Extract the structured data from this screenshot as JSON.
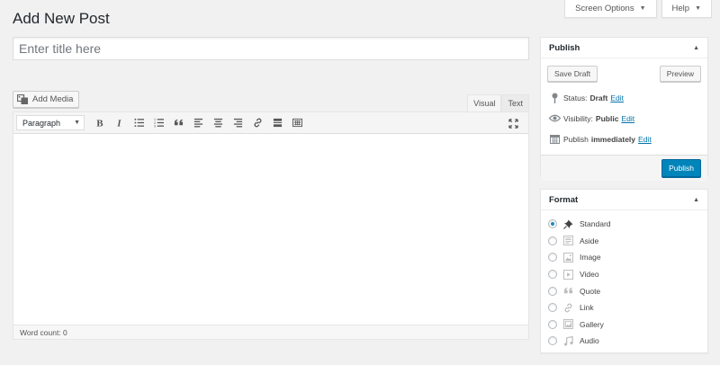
{
  "page": {
    "title": "Add New Post"
  },
  "top_tabs": [
    {
      "label": "Screen Options"
    },
    {
      "label": "Help"
    }
  ],
  "title_field": {
    "placeholder": "Enter title here",
    "value": ""
  },
  "add_media": {
    "label": "Add Media",
    "icon": "media-icon"
  },
  "editor_tabs": [
    {
      "label": "Visual",
      "active": true
    },
    {
      "label": "Text",
      "active": false
    }
  ],
  "toolbar": {
    "format_select": "Paragraph",
    "buttons": [
      "bold-icon",
      "italic-icon",
      "bullet-list-icon",
      "numbered-list-icon",
      "blockquote-icon",
      "align-left-icon",
      "align-center-icon",
      "align-right-icon",
      "link-icon",
      "read-more-icon",
      "toolbar-toggle-icon"
    ],
    "fullscreen": "fullscreen-icon"
  },
  "status_bar": {
    "word_count": "Word count: 0"
  },
  "publish_box": {
    "title": "Publish",
    "save_draft": "Save Draft",
    "preview": "Preview",
    "status_label": "Status:",
    "status_value": "Draft",
    "visibility_label": "Visibility:",
    "visibility_value": "Public",
    "publish_label": "Publish",
    "publish_value": "immediately",
    "edit": "Edit",
    "publish_button": "Publish",
    "accent": "#0085ba"
  },
  "format_box": {
    "title": "Format",
    "options": [
      {
        "label": "Standard",
        "icon": "pin-icon",
        "checked": true
      },
      {
        "label": "Aside",
        "icon": "aside-icon",
        "checked": false
      },
      {
        "label": "Image",
        "icon": "image-icon",
        "checked": false
      },
      {
        "label": "Video",
        "icon": "video-icon",
        "checked": false
      },
      {
        "label": "Quote",
        "icon": "quote-icon",
        "checked": false
      },
      {
        "label": "Link",
        "icon": "link-icon",
        "checked": false
      },
      {
        "label": "Gallery",
        "icon": "gallery-icon",
        "checked": false
      },
      {
        "label": "Audio",
        "icon": "audio-icon",
        "checked": false
      }
    ]
  }
}
